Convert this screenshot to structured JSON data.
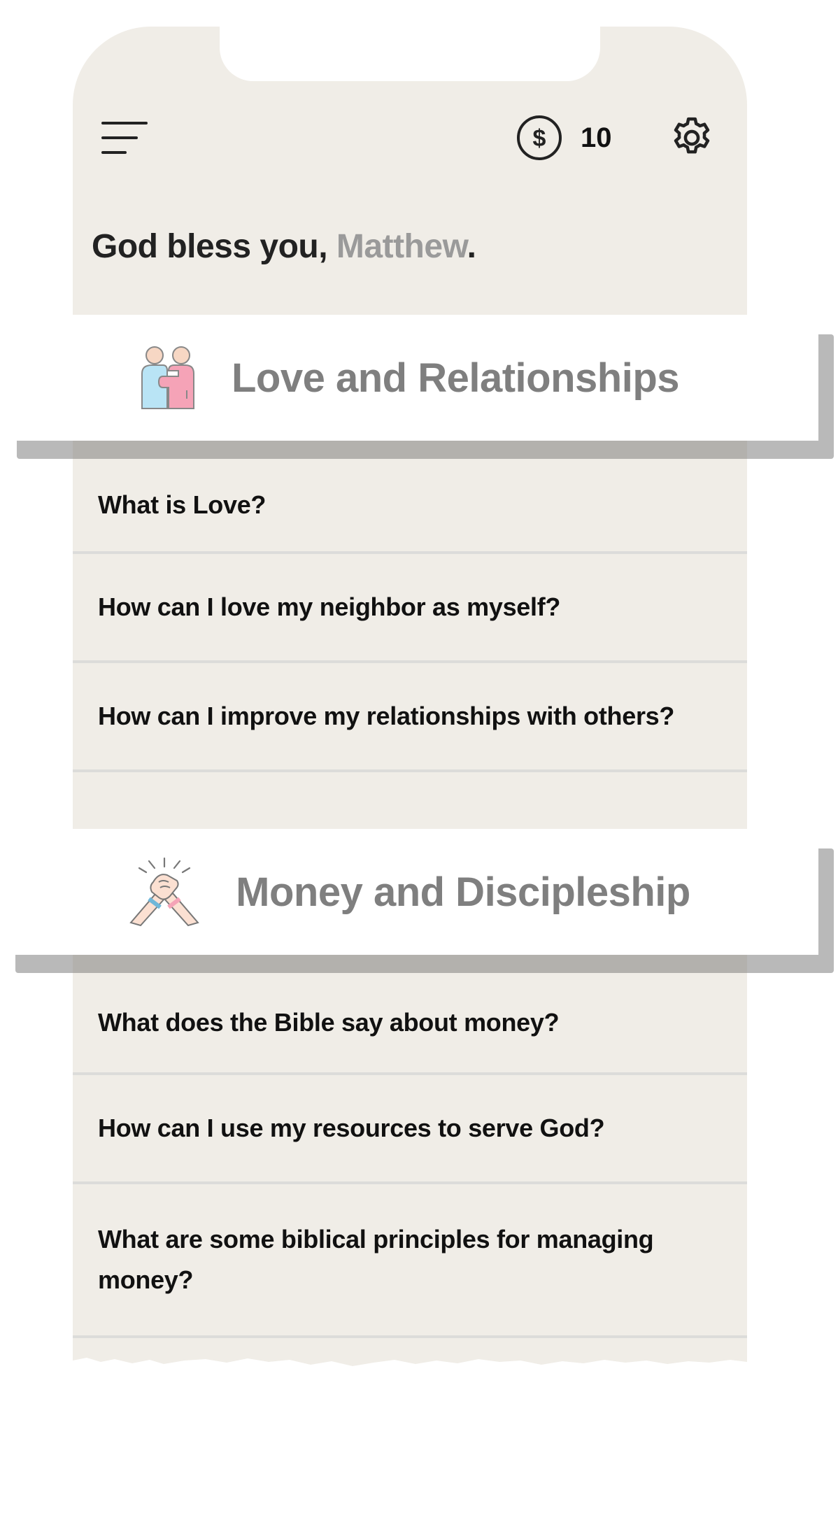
{
  "header": {
    "menu_icon": "hamburger-menu-icon",
    "coin_icon": "dollar-coin-icon",
    "coin_count": "10",
    "settings_icon": "gear-icon"
  },
  "greeting": {
    "prefix": "God bless you, ",
    "name": "Matthew",
    "suffix": "."
  },
  "categories": [
    {
      "title": "Love and Relationships",
      "icon": "hugging-people-icon",
      "questions": [
        "What is Love?",
        "How can I love my neighbor as myself?",
        "How can I improve my relationships with others?"
      ]
    },
    {
      "title": "Money and Discipleship",
      "icon": "handshake-icon",
      "questions": [
        "What does the Bible say about money?",
        "How can I use my resources to serve God?",
        "What are some biblical principles for managing money?"
      ]
    }
  ],
  "colors": {
    "background": "#f0ede7",
    "card": "#ffffff",
    "title_gray": "#7f7f7f",
    "name_gray": "#9a9a9a",
    "shadow": "#b9b9b9"
  }
}
